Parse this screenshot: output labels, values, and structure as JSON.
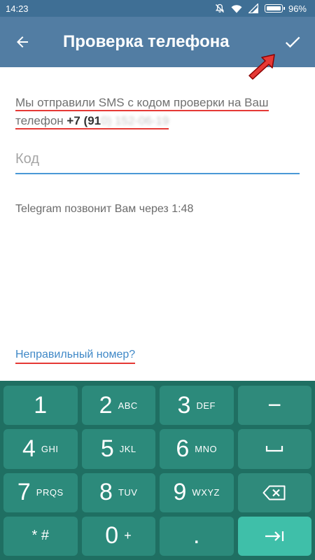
{
  "status_bar": {
    "time": "14:23",
    "battery_percent": "96%",
    "icons": [
      "mute-bell-icon",
      "wifi-icon",
      "signal-icon",
      "battery-icon"
    ]
  },
  "app_bar": {
    "title": "Проверка телефона",
    "back_icon": "arrow-left-icon",
    "done_icon": "checkmark-icon"
  },
  "content": {
    "sms_line1": "Мы отправили SMS с кодом проверки на Ваш",
    "sms_line2_prefix": "телефон ",
    "phone_visible": "+7 (91",
    "phone_hidden": "0) 152-06-19",
    "code_placeholder": "Код",
    "code_value": "",
    "call_timer_text": "Telegram позвонит Вам через 1:48",
    "wrong_number_link": "Неправильный номер?"
  },
  "keypad": {
    "keys": [
      {
        "num": "1",
        "letters": ""
      },
      {
        "num": "2",
        "letters": "ABC"
      },
      {
        "num": "3",
        "letters": "DEF"
      },
      {
        "num": "4",
        "letters": "GHI"
      },
      {
        "num": "5",
        "letters": "JKL"
      },
      {
        "num": "6",
        "letters": "MNO"
      },
      {
        "num": "7",
        "letters": "PRQS"
      },
      {
        "num": "8",
        "letters": "TUV"
      },
      {
        "num": "9",
        "letters": "WXYZ"
      },
      {
        "num": "* #",
        "letters": ""
      },
      {
        "num": "0",
        "letters": "+"
      },
      {
        "num": ".",
        "letters": ""
      }
    ],
    "action_keys": [
      "minus-key",
      "space-key",
      "backspace-key",
      "enter-key"
    ],
    "minus_symbol": "−"
  },
  "colors": {
    "status_bar": "#3f6f95",
    "app_bar": "#527da3",
    "keypad_bg": "#1f6f62",
    "key": "#2c8a7b",
    "enter_key": "#3fbfa9",
    "accent_underline": "#4a98d6",
    "link": "#3f88c7",
    "annotation_red": "#e53935"
  }
}
